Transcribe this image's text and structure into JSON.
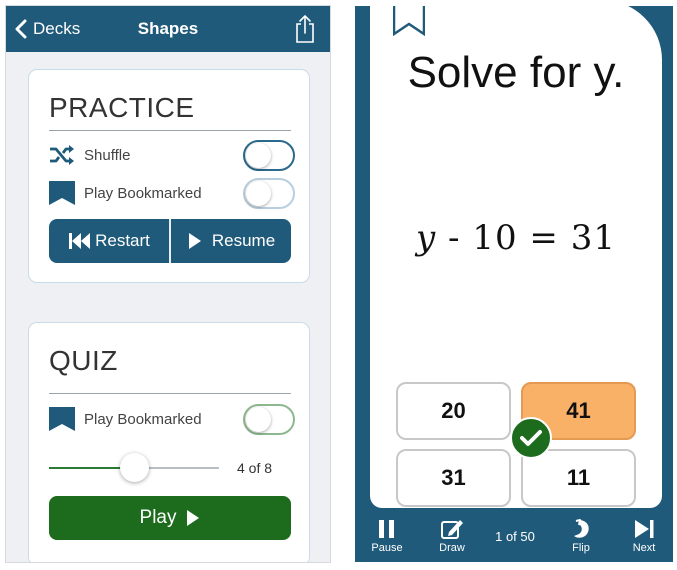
{
  "colors": {
    "nav_bar": "#1f5a7a",
    "card_border": "#c9dbe8",
    "practice_buttons": "#1f5a7a",
    "play_button": "#1d6b1d",
    "selected_answer": "#f9b067",
    "correct_badge": "#1d6b1d"
  },
  "left_screen": {
    "nav": {
      "back_label": "Decks",
      "title": "Shapes",
      "back_icon": "chevron-left-icon",
      "share_icon": "share-icon"
    },
    "practice": {
      "title": "PRACTICE",
      "shuffle": {
        "label": "Shuffle",
        "icon": "shuffle-icon",
        "on": false
      },
      "bookmarked": {
        "label": "Play Bookmarked",
        "icon": "bookmark-icon",
        "on": false
      },
      "restart_label": "Restart",
      "resume_label": "Resume"
    },
    "quiz": {
      "title": "QUIZ",
      "bookmarked": {
        "label": "Play Bookmarked",
        "icon": "bookmark-icon",
        "on": false
      },
      "slider": {
        "value": 4,
        "max": 8,
        "text": "4 of 8"
      },
      "play_label": "Play"
    }
  },
  "right_screen": {
    "question": "Solve for y.",
    "equation": {
      "variable": "y",
      "rest": " - 10 = 31"
    },
    "answers": [
      {
        "value": "20",
        "selected": false
      },
      {
        "value": "41",
        "selected": true
      },
      {
        "value": "31",
        "selected": false
      },
      {
        "value": "11",
        "selected": false
      }
    ],
    "toolbar": {
      "pause_label": "Pause",
      "draw_label": "Draw",
      "counter": "1 of 50",
      "flip_label": "Flip",
      "next_label": "Next"
    }
  }
}
